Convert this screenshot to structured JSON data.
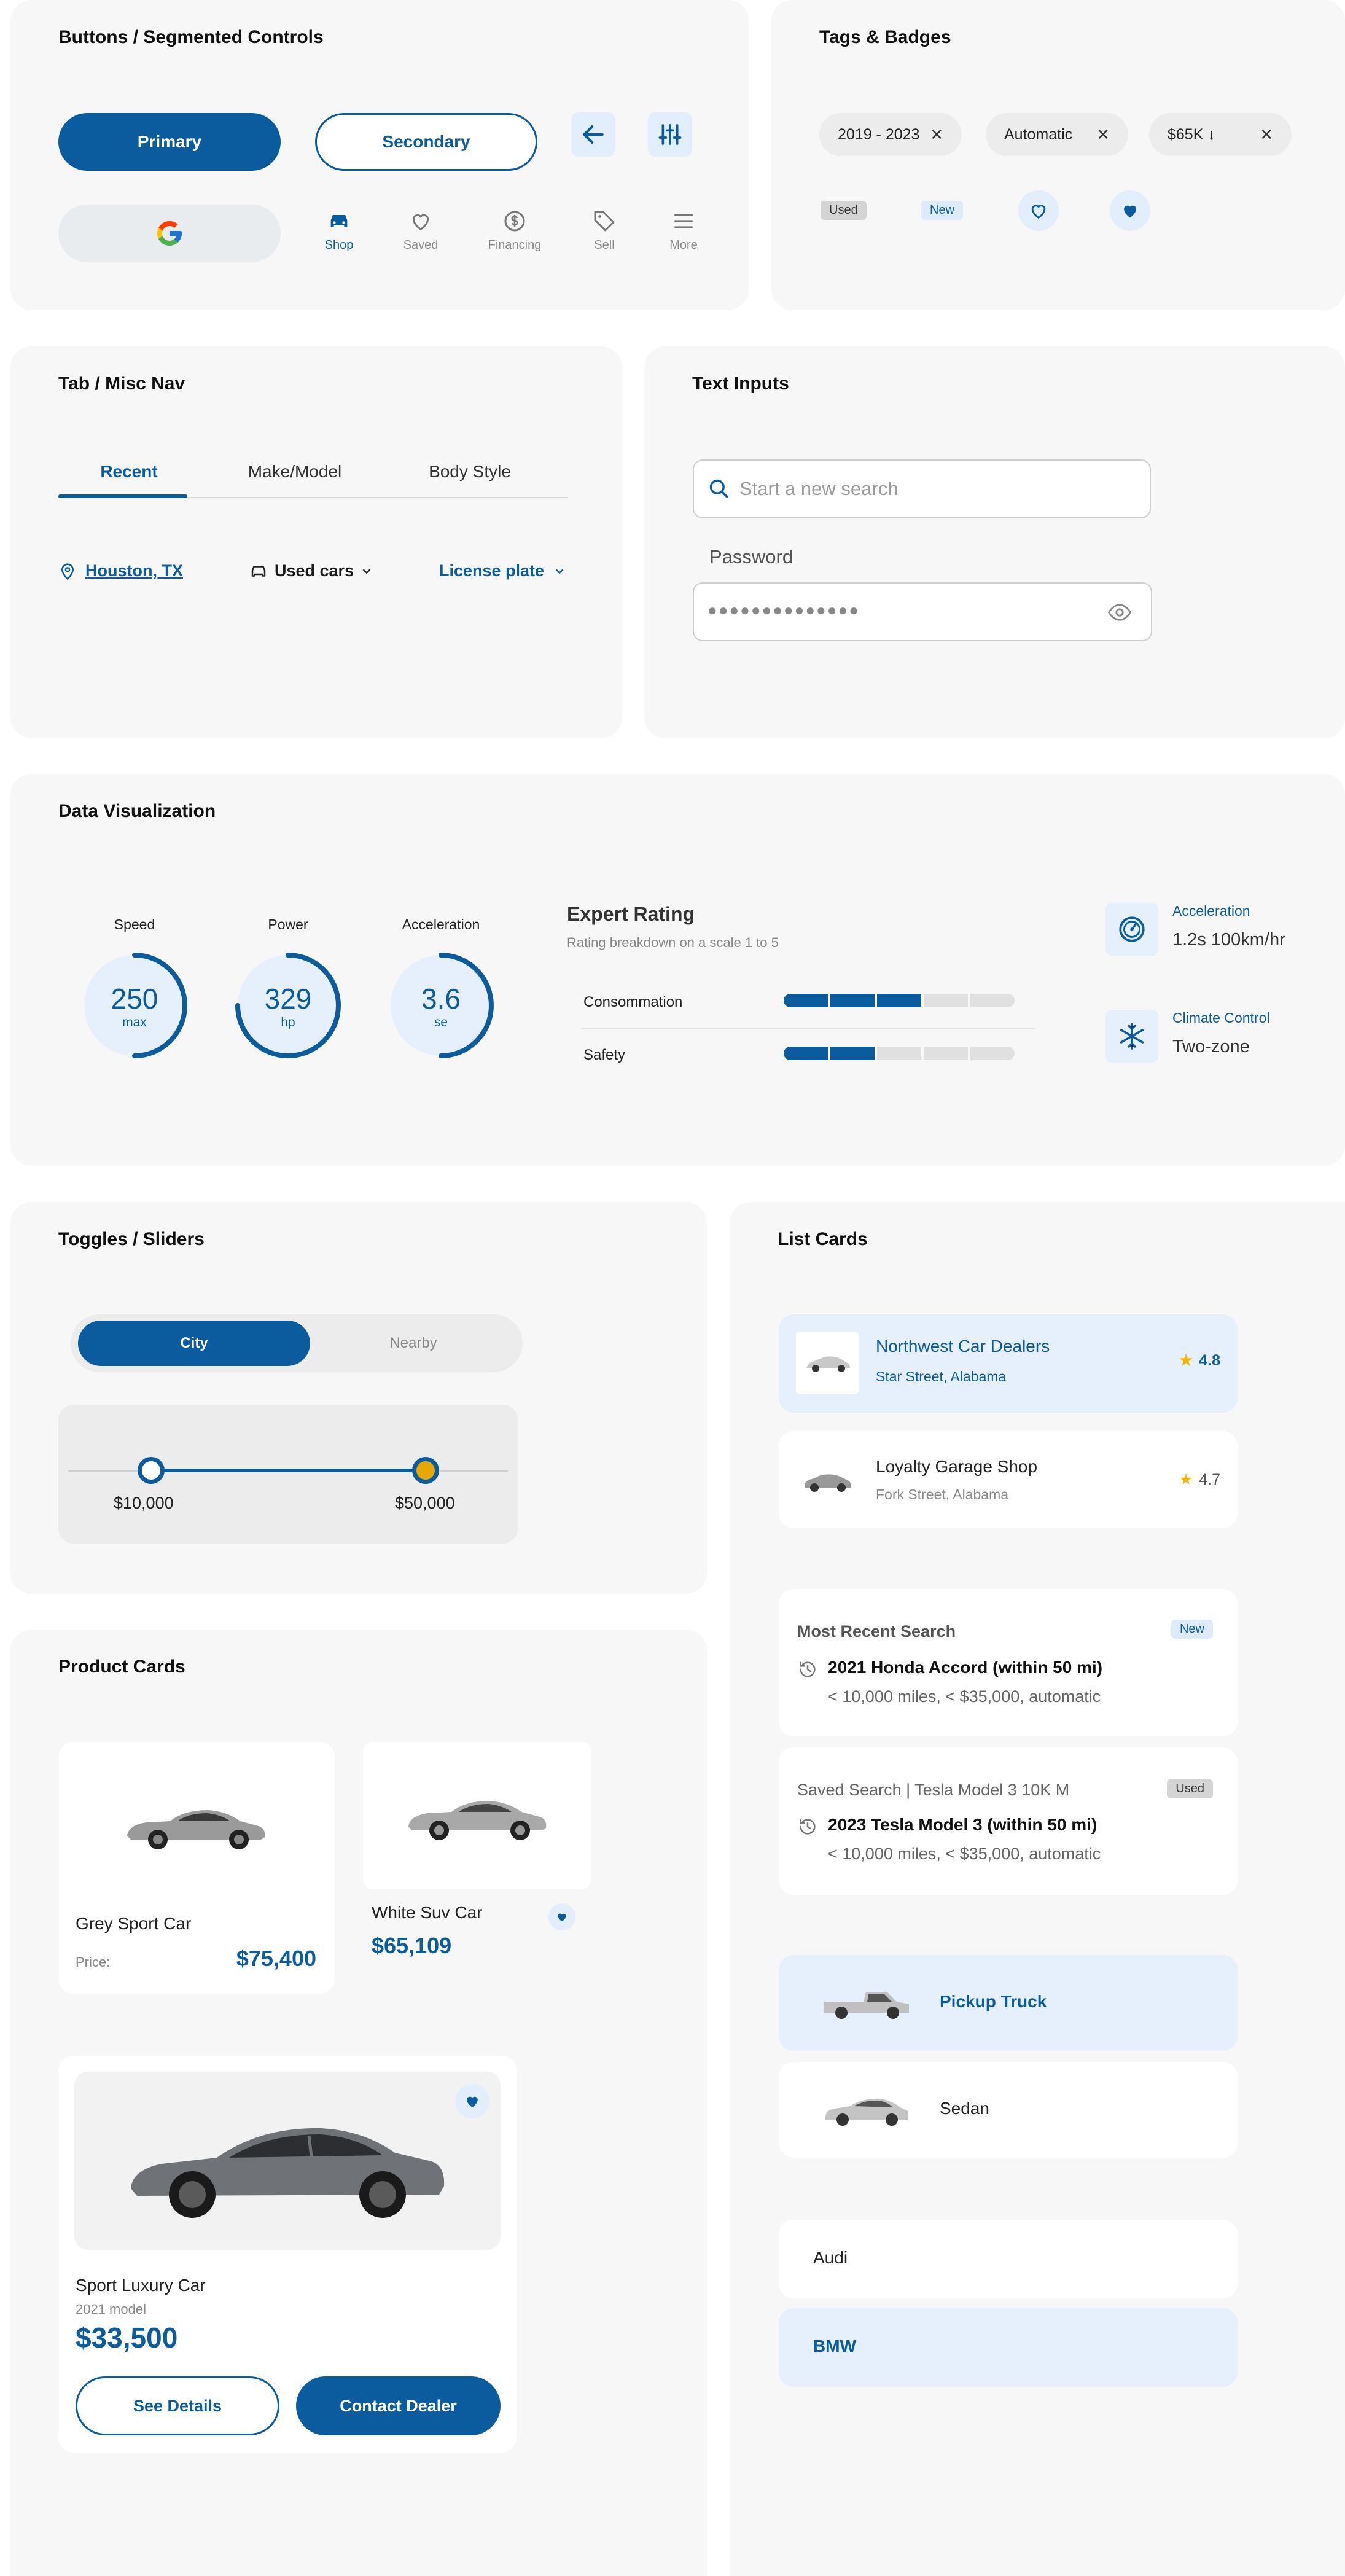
{
  "sections": {
    "buttons": "Buttons / Segmented Controls",
    "tags": "Tags & Badges",
    "tabs": "Tab / Misc Nav",
    "inputs": "Text Inputs",
    "dataviz": "Data Visualization",
    "toggles": "Toggles / Sliders",
    "list_cards": "List Cards",
    "product_cards": "Product Cards"
  },
  "buttons": {
    "primary": "Primary",
    "secondary": "Secondary",
    "back_icon": "arrow-left-icon",
    "filter_icon": "sliders-icon",
    "google_icon": "google-logo"
  },
  "bottom_nav": [
    {
      "label": "Shop",
      "icon": "car-icon",
      "active": true
    },
    {
      "label": "Saved",
      "icon": "heart-icon",
      "active": false
    },
    {
      "label": "Financing",
      "icon": "dollar-icon",
      "active": false
    },
    {
      "label": "Sell",
      "icon": "tag-icon",
      "active": false
    },
    {
      "label": "More",
      "icon": "menu-icon",
      "active": false
    }
  ],
  "tags": {
    "chips": [
      "2019 - 2023",
      "Automatic",
      "$65K ↓"
    ],
    "badge_used": "Used",
    "badge_new": "New"
  },
  "tabs": {
    "items": [
      "Recent",
      "Make/Model",
      "Body Style"
    ],
    "active": "Recent",
    "location": "Houston, TX",
    "used_cars": "Used cars",
    "license_plate": "License plate"
  },
  "inputs": {
    "search_placeholder": "Start a new search",
    "password_label": "Password",
    "password_value": "●●●●●●●●●●●●●●"
  },
  "gauges": [
    {
      "label": "Speed",
      "value": "250",
      "unit": "max",
      "fraction": 0.5
    },
    {
      "label": "Power",
      "value": "329",
      "unit": "hp",
      "fraction": 0.75
    },
    {
      "label": "Acceleration",
      "value": "3.6",
      "unit": "se",
      "fraction": 0.5
    }
  ],
  "rating": {
    "title": "Expert Rating",
    "subtitle": "Rating breakdown on a scale 1 to 5",
    "rows": [
      {
        "label": "Consommation",
        "score": 3,
        "max": 5
      },
      {
        "label": "Safety",
        "score": 2,
        "max": 5
      }
    ]
  },
  "specs": [
    {
      "label": "Acceleration",
      "value": "1.2s 100km/hr",
      "icon": "gauge-icon"
    },
    {
      "label": "Climate Control",
      "value": "Two-zone",
      "icon": "snowflake-icon"
    }
  ],
  "toggle": {
    "left": "City",
    "right": "Nearby",
    "active": "City"
  },
  "slider": {
    "min_label": "$10,000",
    "max_label": "$50,000"
  },
  "dealers": [
    {
      "name": "Northwest Car Dealers",
      "address": "Star Street, Alabama",
      "rating": "4.8"
    },
    {
      "name": "Loyalty Garage Shop",
      "address": "Fork Street, Alabama",
      "rating": "4.7"
    }
  ],
  "searches": [
    {
      "header": "Most Recent Search",
      "badge": "New",
      "title": "2021 Honda Accord (within 50 mi)",
      "detail": "< 10,000 miles, < $35,000, automatic"
    },
    {
      "header": "Saved Search | Tesla Model 3 10K M",
      "badge": "Used",
      "title": "2023 Tesla Model 3 (within 50 mi)",
      "detail": "< 10,000 miles, < $35,000, automatic"
    }
  ],
  "body_styles": [
    "Pickup Truck",
    "Sedan"
  ],
  "makes": [
    "Audi",
    "BMW"
  ],
  "products": [
    {
      "name": "Grey Sport Car",
      "price_label": "Price:",
      "price": "$75,400"
    },
    {
      "name": "White Suv Car",
      "price": "$65,109"
    }
  ],
  "featured": {
    "name": "Sport Luxury Car",
    "model": "2021 model",
    "price": "$33,500",
    "details_btn": "See Details",
    "contact_btn": "Contact Dealer"
  },
  "colors": {
    "accent": "#0b5c9e",
    "accent_light": "#e5f0fc",
    "star": "#f4b400",
    "slider_handle": "#e8a800"
  }
}
